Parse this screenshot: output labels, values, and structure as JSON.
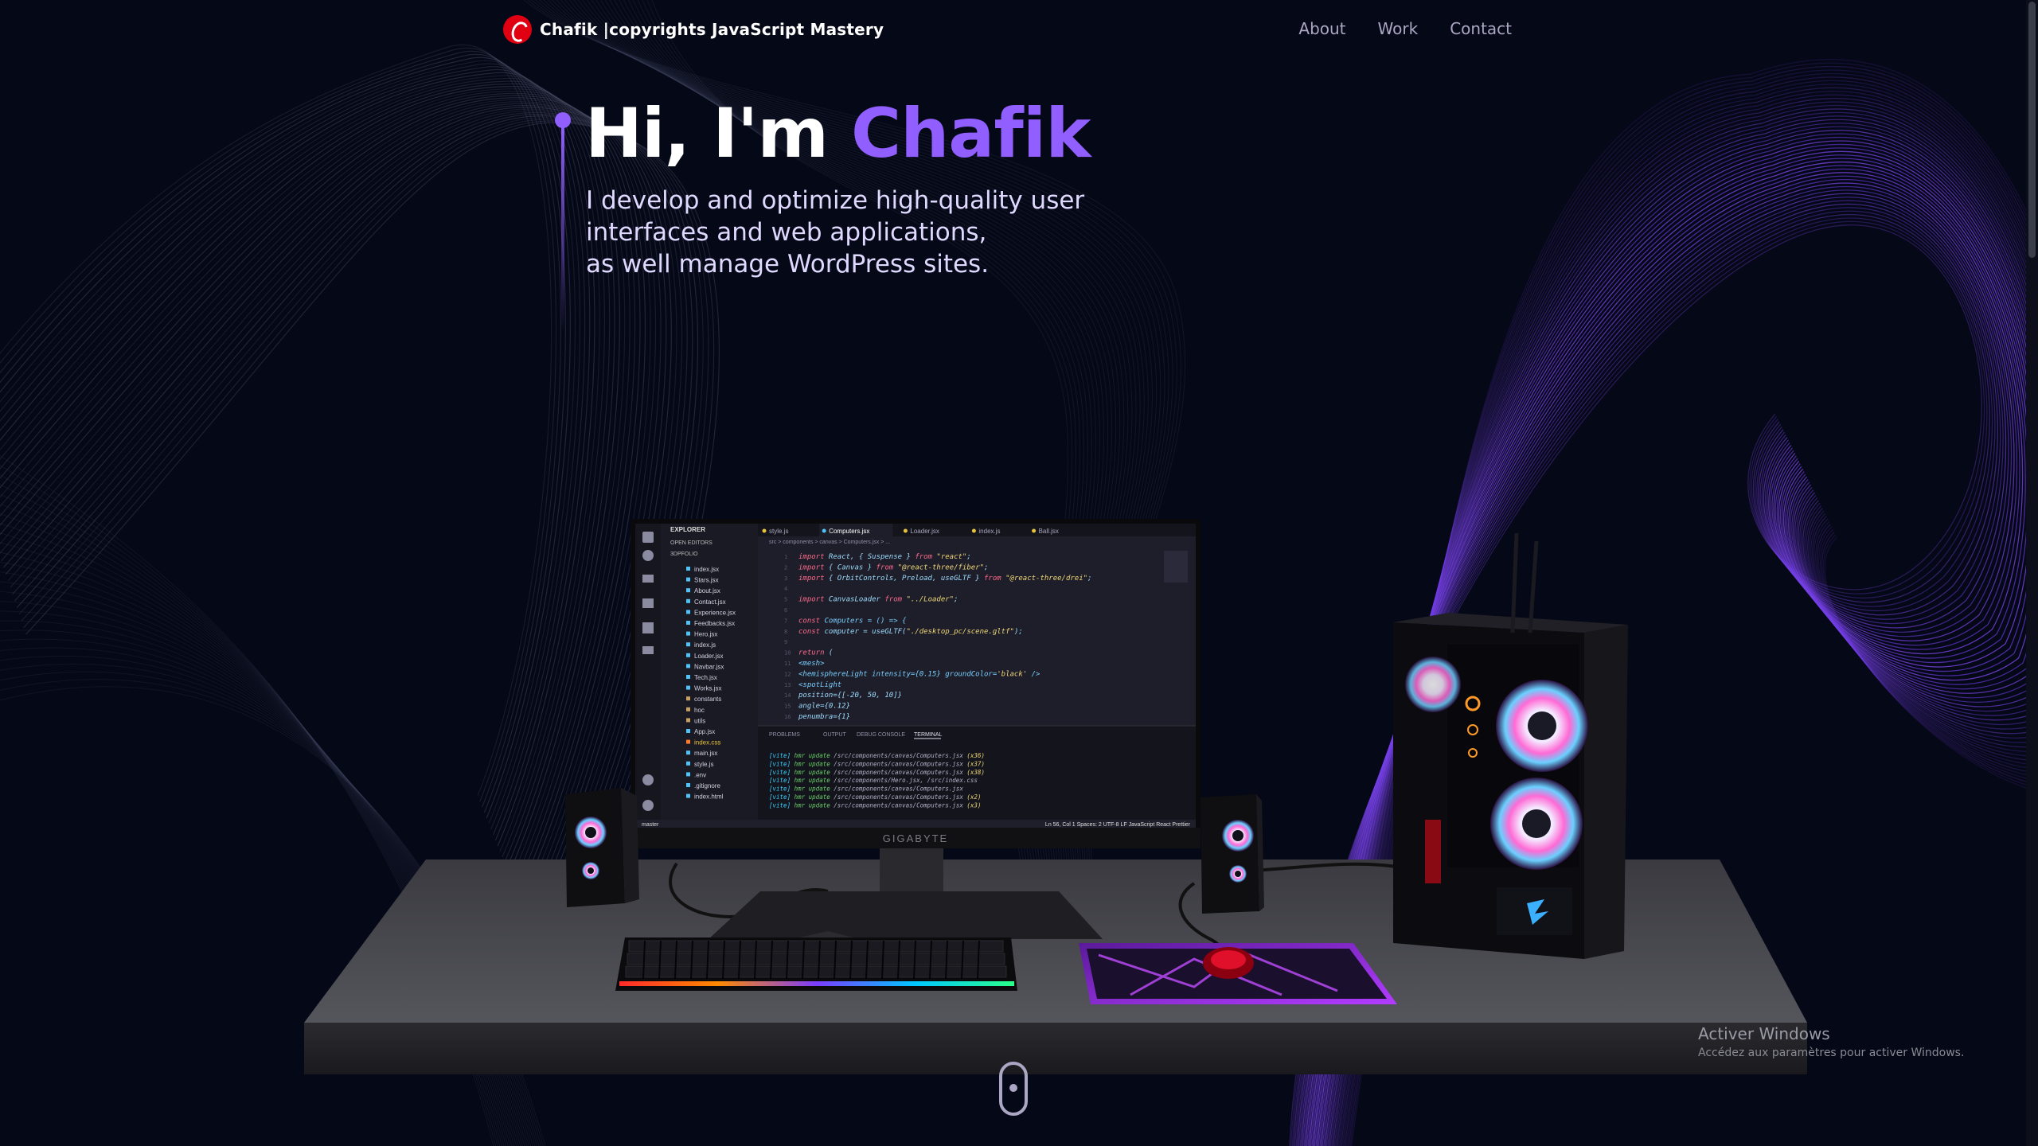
{
  "navbar": {
    "brand": "Chafik  |copyrights JavaScript Mastery",
    "links": [
      "About",
      "Work",
      "Contact"
    ]
  },
  "hero": {
    "greeting": "Hi, I'm ",
    "name": "Chafik",
    "subtitle_lines": [
      "I develop and optimize high-quality user",
      "interfaces and web applications,",
      "as well manage WordPress sites."
    ]
  },
  "scene": {
    "monitor_brand": "GIGABYTE",
    "editor": {
      "tabs": [
        "style.js",
        "Computers.jsx",
        "Loader.jsx",
        "index.js",
        "Ball.jsx"
      ],
      "code_lines": [
        "import React, { Suspense } from \"react\";",
        "import { Canvas } from \"@react-three/fiber\";",
        "import { OrbitControls, Preload, useGLTF } from \"@react-three/drei\";",
        "",
        "import CanvasLoader from \"../Loader\";",
        "",
        "const Computers = () => {",
        "  const computer = useGLTF(\"./desktop_pc/scene.gltf\");",
        "",
        "  return (",
        "    <mesh>",
        "      <hemisphereLight intensity={0.15} groundColor='black' />",
        "      <spotLight",
        "        position={[-20, 50, 10]}",
        "        angle={0.12}",
        "        penumbra={1}"
      ],
      "terminal_lines": [
        "[vite] hmr update /src/components/canvas/Computers.jsx (x36)",
        "[vite] hmr update /src/components/canvas/Computers.jsx (x37)",
        "[vite] hmr update /src/components/canvas/Computers.jsx (x38)",
        "[vite] hmr update /src/components/Hero.jsx, /src/index.css",
        "[vite] hmr update /src/components/canvas/Computers.jsx",
        "[vite] hmr update /src/components/canvas/Computers.jsx (x2)",
        "[vite] hmr update /src/components/canvas/Computers.jsx (x3)"
      ],
      "file_tree": [
        "index.jsx",
        "Stars.jsx",
        "About.jsx",
        "Contact.jsx",
        "Experience.jsx",
        "Feedbacks.jsx",
        "Hero.jsx",
        "index.js",
        "Loader.jsx",
        "Navbar.jsx",
        "Tech.jsx",
        "Works.jsx",
        "constants",
        "hoc",
        "utils",
        "App.jsx",
        "index.css",
        "main.jsx",
        "style.js",
        ".env",
        ".gitignore",
        "index.html"
      ],
      "status_left": "master",
      "status_right": "Ln 56, Col 1   Spaces: 2   UTF-8   LF   JavaScript React   Prettier"
    }
  },
  "watermark": {
    "title": "Activer Windows",
    "subtitle": "Accédez aux paramètres pour activer Windows."
  },
  "colors": {
    "background": "#050816",
    "accent": "#915eff",
    "nav_text": "#aaa6c3",
    "brand_logo": "#e00012"
  }
}
